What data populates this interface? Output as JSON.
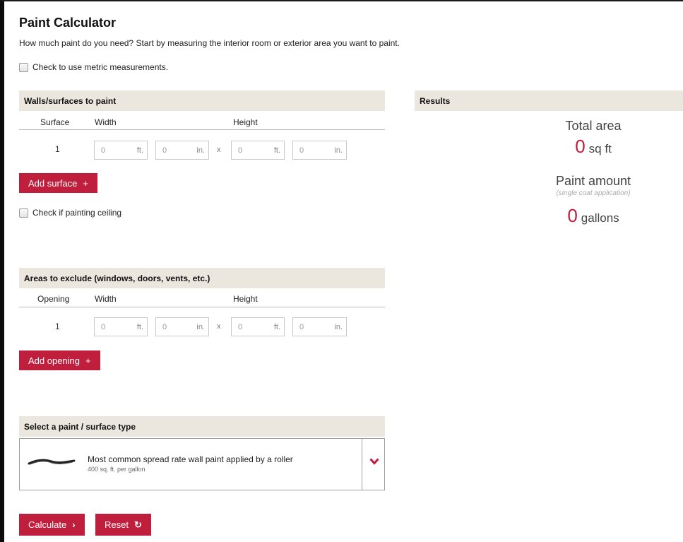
{
  "page": {
    "title": "Paint Calculator",
    "intro": "How much paint do you need? Start by measuring the interior room or exterior area you want to paint.",
    "metric_label": "Check to use metric measurements."
  },
  "surfaces": {
    "heading": "Walls/surfaces to paint",
    "col_surface": "Surface",
    "col_width": "Width",
    "col_height": "Height",
    "row_number": "1",
    "width_ft": "0",
    "width_in": "0",
    "height_ft": "0",
    "height_in": "0",
    "unit_ft": "ft.",
    "unit_in": "in.",
    "times": "x",
    "add_label": "Add surface",
    "add_icon": "+",
    "ceiling_label": "Check if painting ceiling"
  },
  "exclude": {
    "heading": "Areas to exclude (windows, doors, vents, etc.)",
    "col_opening": "Opening",
    "col_width": "Width",
    "col_height": "Height",
    "row_number": "1",
    "width_ft": "0",
    "width_in": "0",
    "height_ft": "0",
    "height_in": "0",
    "unit_ft": "ft.",
    "unit_in": "in.",
    "times": "x",
    "add_label": "Add opening",
    "add_icon": "+"
  },
  "paint_type": {
    "heading": "Select a paint / surface type",
    "selected_main": "Most common spread rate wall paint applied by a roller",
    "selected_sub": "400 sq. ft. per gallon",
    "stroke_icon": "brush-stroke-icon",
    "chevron_icon": "chevron-down-icon"
  },
  "actions": {
    "calculate": "Calculate",
    "calculate_icon": "›",
    "reset": "Reset",
    "reset_icon": "↻"
  },
  "results": {
    "heading": "Results",
    "total_area_label": "Total area",
    "total_area_value": "0",
    "total_area_unit": "sq ft",
    "paint_amount_label": "Paint amount",
    "paint_amount_note": "(single coat application)",
    "paint_amount_value": "0",
    "paint_amount_unit": "gallons"
  },
  "colors": {
    "accent": "#bf1e3c",
    "section_bg": "#ece7de"
  }
}
